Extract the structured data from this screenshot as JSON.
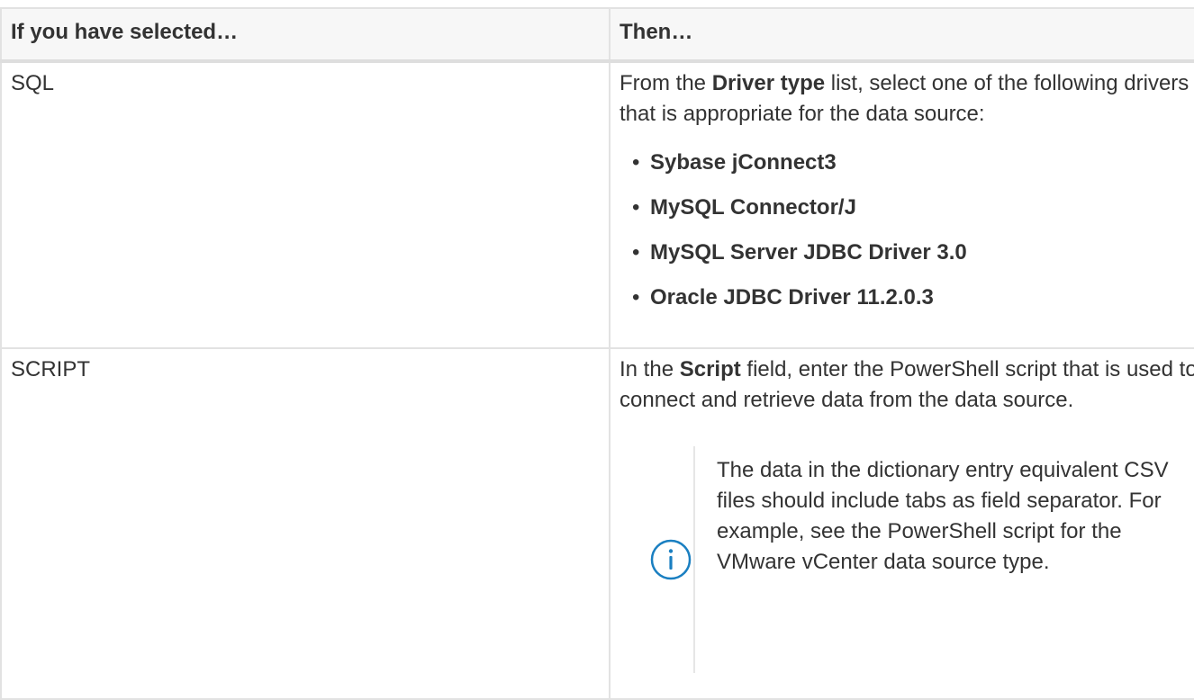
{
  "table": {
    "headers": [
      "If you have selected…",
      "Then…"
    ],
    "sql": {
      "label": "SQL",
      "intro_pre": "From the ",
      "intro_bold": "Driver type",
      "intro_post": " list, select one of the following drivers that is appropriate for the data source:",
      "drivers": [
        "Sybase jConnect3",
        "MySQL Connector/J",
        "MySQL Server JDBC Driver 3.0",
        "Oracle JDBC Driver 11.2.0.3"
      ]
    },
    "script": {
      "label": "SCRIPT",
      "intro_pre": "In the ",
      "intro_bold": "Script",
      "intro_post": " field, enter the PowerShell script that is used to connect and retrieve data from the data source.",
      "note_icon": "info-icon",
      "note_text": "The data in the dictionary entry equivalent CSV files should include tabs as field separator. For example, see the PowerShell script for the VMware vCenter data source type."
    }
  },
  "colors": {
    "info_icon": "#1a7fc1",
    "border": "#e2e2e2",
    "header_bg": "#f7f7f7",
    "text": "#333333"
  }
}
